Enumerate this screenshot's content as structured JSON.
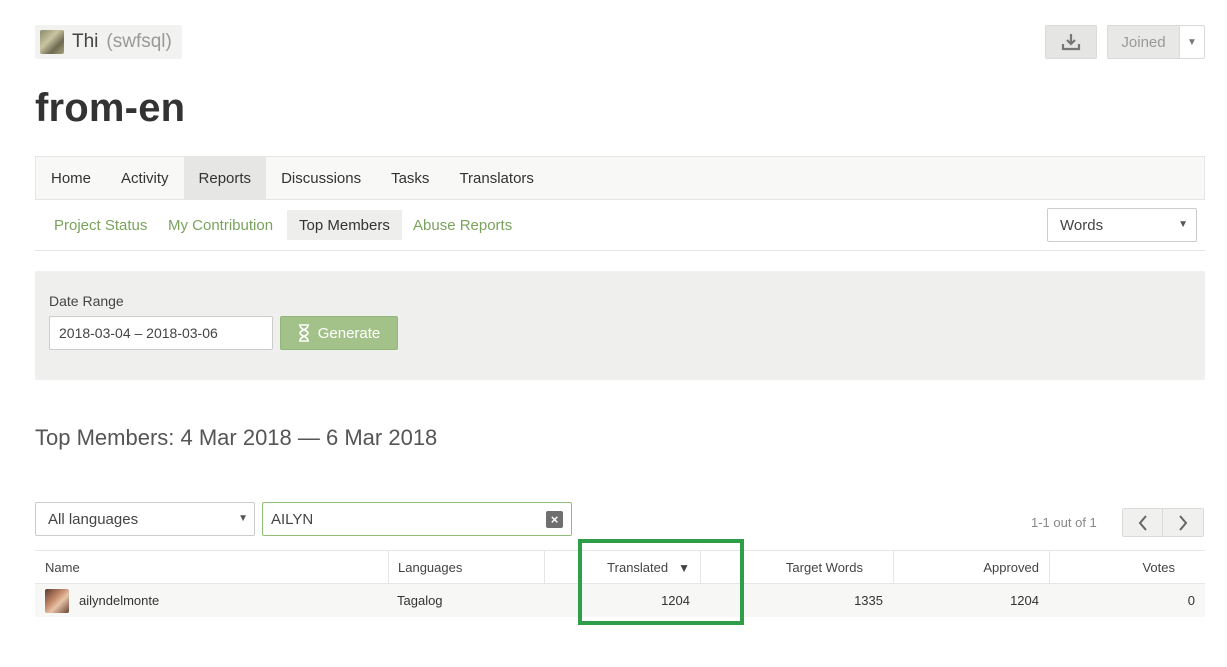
{
  "header": {
    "owner_name": "Thi",
    "owner_handle": "(swfsql)",
    "joined_label": "Joined",
    "project_title": "from-en"
  },
  "main_tabs": [
    {
      "label": "Home",
      "active": false
    },
    {
      "label": "Activity",
      "active": false
    },
    {
      "label": "Reports",
      "active": true
    },
    {
      "label": "Discussions",
      "active": false
    },
    {
      "label": "Tasks",
      "active": false
    },
    {
      "label": "Translators",
      "active": false
    }
  ],
  "sub_tabs": [
    {
      "label": "Project Status",
      "active": false
    },
    {
      "label": "My Contribution",
      "active": false
    },
    {
      "label": "Top Members",
      "active": true
    },
    {
      "label": "Abuse Reports",
      "active": false
    }
  ],
  "metric_select": {
    "value": "Words"
  },
  "date_panel": {
    "label": "Date Range",
    "value": "2018-03-04 – 2018-03-06",
    "generate_label": "Generate"
  },
  "section_title": "Top Members: 4 Mar 2018 — 6 Mar 2018",
  "filters": {
    "language_value": "All languages",
    "search_value": "AILYN"
  },
  "pagination": {
    "text": "1-1 out of 1"
  },
  "table": {
    "headers": {
      "name": "Name",
      "languages": "Languages",
      "translated": "Translated",
      "target_words": "Target Words",
      "approved": "Approved",
      "votes": "Votes"
    },
    "sort_indicator": "▼",
    "rows": [
      {
        "name": "ailyndelmonte",
        "languages": "Tagalog",
        "translated": "1204",
        "target_words": "1335",
        "approved": "1204",
        "votes": "0"
      }
    ]
  },
  "colors": {
    "accent_green": "#7aa35e",
    "generate_green": "#a3c28a",
    "highlight_green": "#2f9e49"
  }
}
